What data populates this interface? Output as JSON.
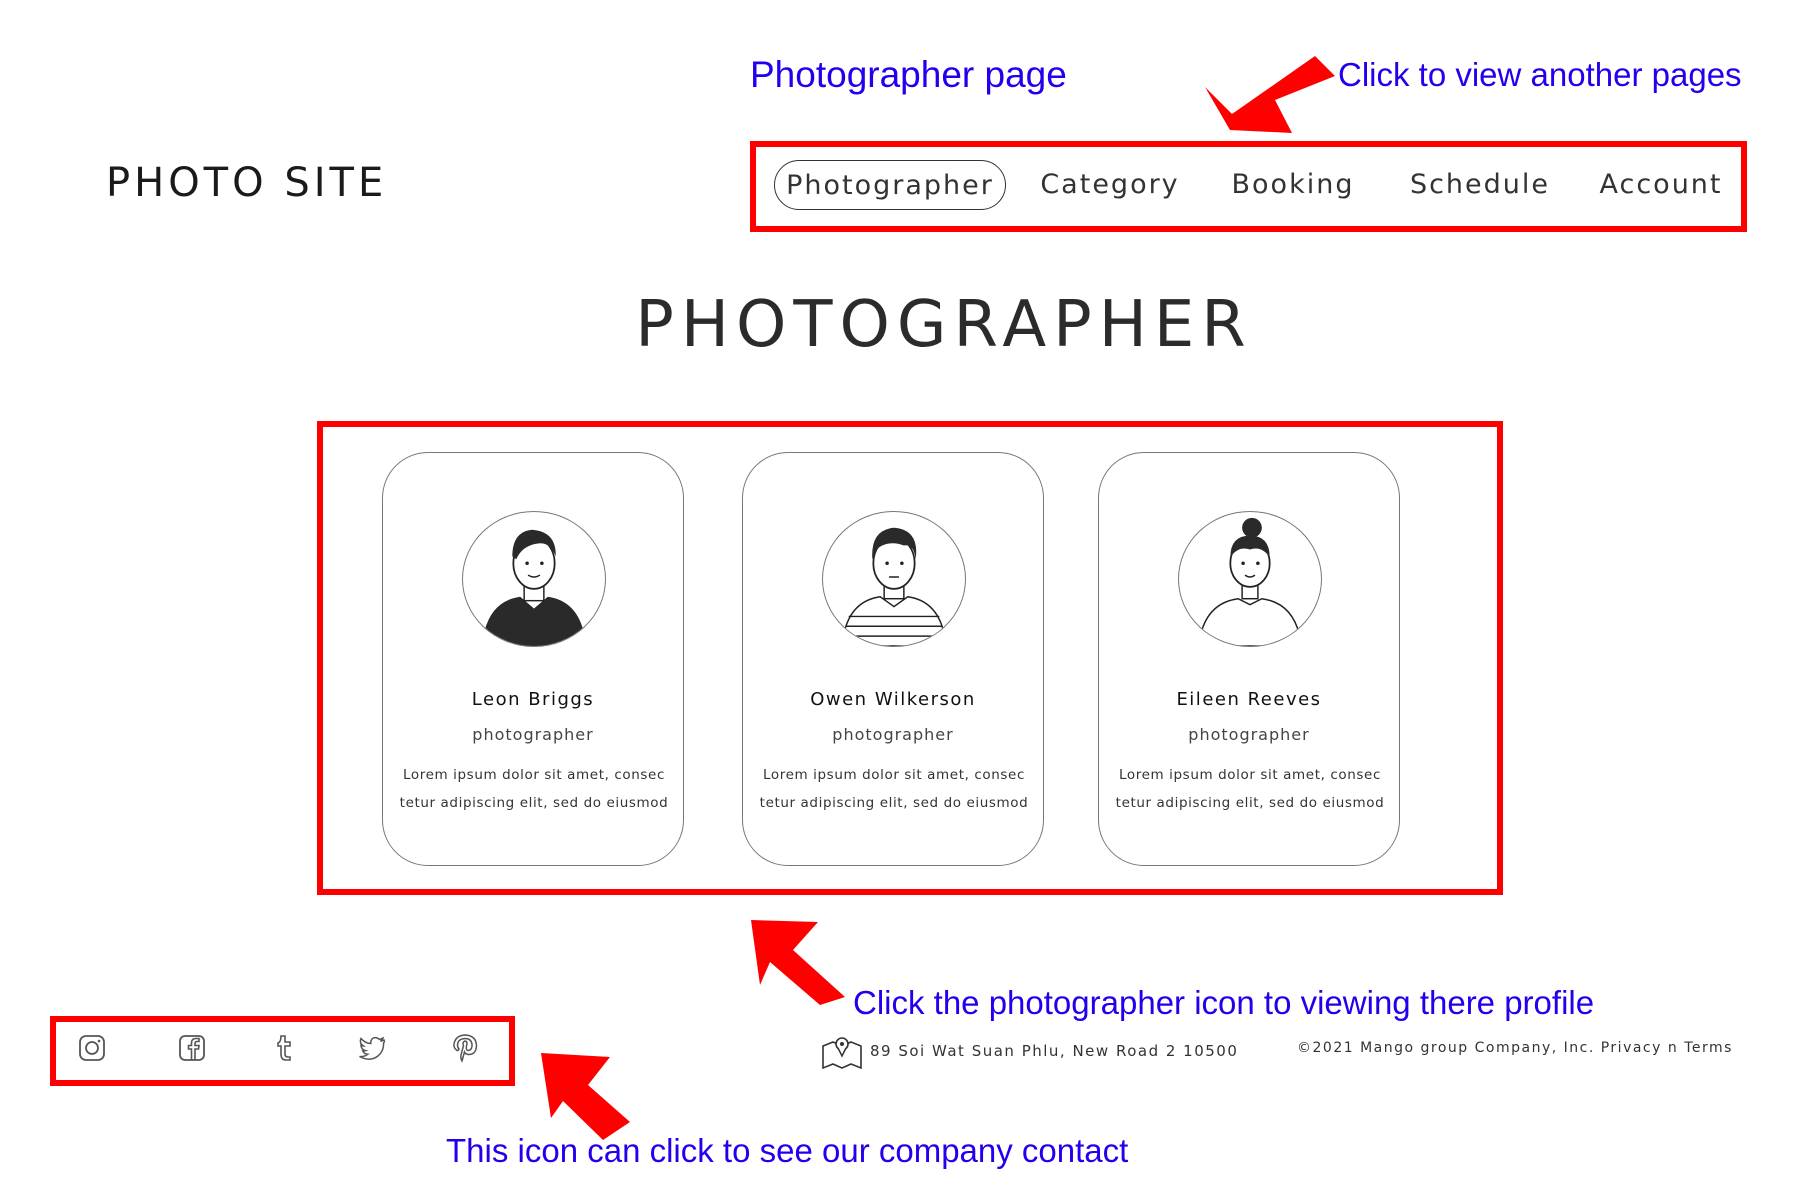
{
  "annotations": {
    "page_label": "Photographer page",
    "nav_hint": "Click to view another pages",
    "cards_hint": "Click the photographer icon to viewing there profile",
    "social_hint": "This icon can click to see our company contact"
  },
  "header": {
    "logo": "PHOTO SITE",
    "nav": [
      {
        "label": "Photographer",
        "active": true
      },
      {
        "label": "Category",
        "active": false
      },
      {
        "label": "Booking",
        "active": false
      },
      {
        "label": "Schedule",
        "active": false
      },
      {
        "label": "Account",
        "active": false
      }
    ]
  },
  "main": {
    "title": "PHOTOGRAPHER",
    "photographers": [
      {
        "name": "Leon Briggs",
        "role": "photographer",
        "desc_line1": "Lorem ipsum dolor sit amet, consec",
        "desc_line2": "tetur adipiscing elit, sed do eiusmod"
      },
      {
        "name": "Owen Wilkerson",
        "role": "photographer",
        "desc_line1": "Lorem ipsum dolor sit amet, consec",
        "desc_line2": "tetur adipiscing elit, sed do eiusmod"
      },
      {
        "name": "Eileen Reeves",
        "role": "photographer",
        "desc_line1": "Lorem ipsum dolor sit amet, consec",
        "desc_line2": "tetur adipiscing elit, sed do eiusmod"
      }
    ]
  },
  "footer": {
    "social_icons": [
      "instagram-icon",
      "facebook-icon",
      "tumblr-icon",
      "twitter-icon",
      "pinterest-icon"
    ],
    "address": "89 Soi Wat Suan Phlu, New Road 2 10500",
    "copyright": "©2021 Mango group Company, Inc. Privacy n Terms"
  },
  "colors": {
    "annotation_text": "#2200ee",
    "annotation_highlight": "#ff0000",
    "text": "#222222",
    "background": "#ffffff"
  }
}
